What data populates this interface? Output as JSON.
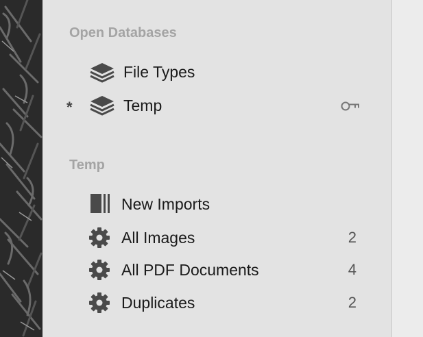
{
  "open_databases": {
    "title": "Open Databases",
    "items": [
      {
        "label": "File Types",
        "icon": "layers-icon"
      },
      {
        "label": "Temp",
        "icon": "layers-icon",
        "marker": "*",
        "status_icon": "key-icon"
      }
    ]
  },
  "temp": {
    "title": "Temp",
    "items": [
      {
        "label": "New Imports",
        "icon": "inbox-icon",
        "count": ""
      },
      {
        "label": "All Images",
        "icon": "gear-icon",
        "count": "2"
      },
      {
        "label": "All PDF Documents",
        "icon": "gear-icon",
        "count": "4"
      },
      {
        "label": "Duplicates",
        "icon": "gear-icon",
        "count": "2"
      }
    ]
  }
}
